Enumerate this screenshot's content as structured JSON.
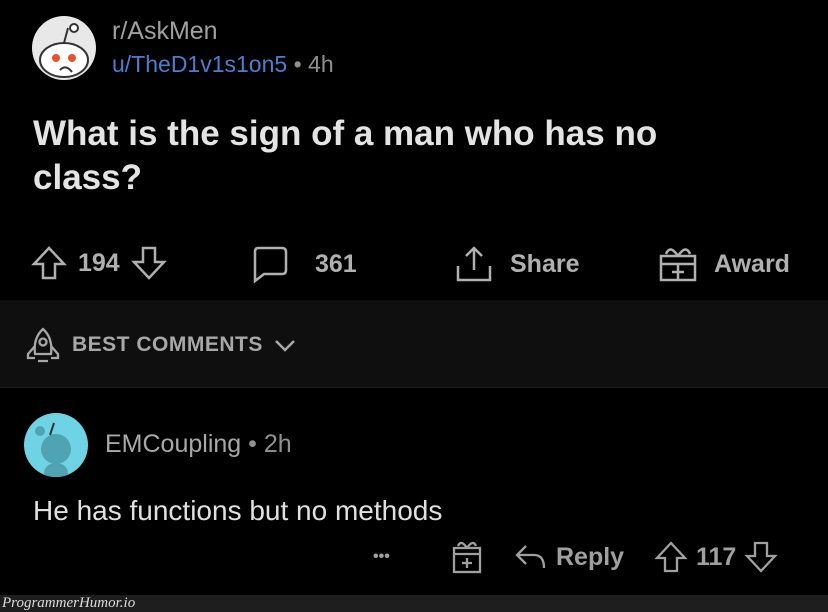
{
  "post": {
    "subreddit": "r/AskMen",
    "author": "u/TheD1v1s1on5",
    "sep": "•",
    "age": "4h",
    "title": "What is the sign of a man who has no class?",
    "votes": "194",
    "comments": "361",
    "share_label": "Share",
    "award_label": "Award"
  },
  "sort": {
    "label": "BEST COMMENTS"
  },
  "comment": {
    "author": "EMCoupling",
    "sep": "•",
    "age": "2h",
    "text": "He has functions but no methods",
    "more": "•••",
    "reply_label": "Reply",
    "votes": "117"
  },
  "watermark": "ProgrammerHumor.io",
  "colors": {
    "username": "#4a7fd0",
    "avatar_comment": "#6fd3e6",
    "snoo_eyes": "#e8512b"
  }
}
